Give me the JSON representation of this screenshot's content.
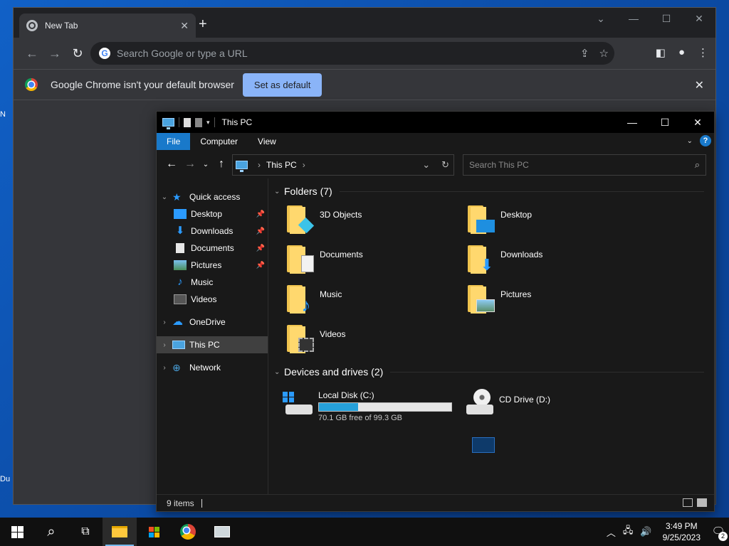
{
  "desktop": {
    "edge_labels": [
      "N",
      "Du"
    ]
  },
  "chrome": {
    "tab_title": "New Tab",
    "new_tab_symbol": "+",
    "omnibox_placeholder": "Search Google or type a URL",
    "infobar_text": "Google Chrome isn't your default browser",
    "set_default_label": "Set as default"
  },
  "explorer": {
    "title": "This PC",
    "ribbon_tabs": [
      "File",
      "Computer",
      "View"
    ],
    "help_label": "?",
    "address": {
      "crumb": "This PC"
    },
    "search_placeholder": "Search This PC",
    "nav": {
      "quick_access": "Quick access",
      "quick_items": [
        {
          "label": "Desktop",
          "pinned": true
        },
        {
          "label": "Downloads",
          "pinned": true
        },
        {
          "label": "Documents",
          "pinned": true
        },
        {
          "label": "Pictures",
          "pinned": true
        },
        {
          "label": "Music",
          "pinned": false
        },
        {
          "label": "Videos",
          "pinned": false
        }
      ],
      "onedrive": "OneDrive",
      "this_pc": "This PC",
      "network": "Network"
    },
    "folders_header": "Folders (7)",
    "folders": [
      {
        "label": "3D Objects",
        "icon": "3d-objects-icon"
      },
      {
        "label": "Desktop",
        "icon": "desktop-folder-icon"
      },
      {
        "label": "Documents",
        "icon": "documents-folder-icon"
      },
      {
        "label": "Downloads",
        "icon": "downloads-folder-icon"
      },
      {
        "label": "Music",
        "icon": "music-folder-icon"
      },
      {
        "label": "Pictures",
        "icon": "pictures-folder-icon"
      },
      {
        "label": "Videos",
        "icon": "videos-folder-icon"
      }
    ],
    "drives_header": "Devices and drives (2)",
    "drives": {
      "c": {
        "name": "Local Disk (C:)",
        "free_text": "70.1 GB free of 99.3 GB",
        "used_fraction": 0.294
      },
      "d": {
        "name": "CD Drive (D:)"
      }
    },
    "status_items": "9 items"
  },
  "taskbar": {
    "time": "3:49 PM",
    "date": "9/25/2023",
    "notification_count": "2"
  },
  "colors": {
    "accent": "#1979ca",
    "usage_fill": "#26a0da",
    "chrome_button": "#8ab4f8"
  }
}
